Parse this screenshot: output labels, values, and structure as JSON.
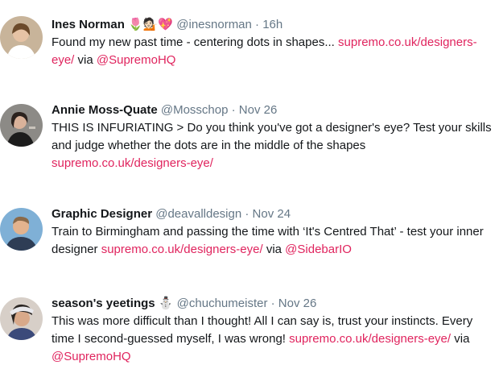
{
  "tweets": [
    {
      "name": "Ines Norman",
      "emojis": [
        "🌷",
        "💁🏻",
        "💖"
      ],
      "handle": "@inesnorman",
      "sep": "·",
      "time": "16h",
      "text1": "Found my new past time - centering dots in shapes... ",
      "link": "supremo.co.uk/designers-eye/",
      "text2": " via ",
      "mention": "@SupremoHQ",
      "avatar_colors": {
        "bg": "#c8b49a",
        "skin": "#e6c3a5",
        "hair": "#6b4a2b",
        "shirt": "#ffffff"
      }
    },
    {
      "name": "Annie Moss-Quate",
      "emojis": [],
      "handle": "@Mosschop",
      "sep": "·",
      "time": "Nov 26",
      "text1": "THIS IS INFURIATING > Do you think you've got a designer's eye? Test your skills and judge whether the dots are in the middle of the shapes",
      "link": "supremo.co.uk/designers-eye/",
      "text2": "",
      "mention": "",
      "avatar_colors": {
        "bg": "#8c8a86",
        "skin": "#d9b29a",
        "hair": "#2b221e",
        "shirt": "#1c1c1c"
      }
    },
    {
      "name": "Graphic Designer",
      "emojis": [],
      "handle": "@deavalldesign",
      "sep": "·",
      "time": "Nov 24",
      "text1": "Train to Birmingham and passing the time with ‘It's Centred That’ - test your inner designer ",
      "link": "supremo.co.uk/designers-eye/",
      "text2": " via ",
      "mention": "@SidebarIO",
      "avatar_colors": {
        "bg": "#7fb0d6",
        "skin": "#e3b38e",
        "hair": "#8a6a4a",
        "shirt": "#2e3d55"
      }
    },
    {
      "name": "season's yeetings",
      "emojis": [
        "⛄"
      ],
      "handle": "@chuchumeister",
      "sep": "·",
      "time": "Nov 26",
      "text1": "This was more difficult than I thought! All I can say is, trust your instincts. Every time I second-guessed myself, I was wrong! ",
      "link": "supremo.co.uk/designers-eye/",
      "text2": " via ",
      "mention": "@SupremoHQ",
      "avatar_colors": {
        "bg": "#d7cfc8",
        "skin": "#d8a98a",
        "hair": "#2a2522",
        "shirt": "#3b4a7a"
      }
    }
  ]
}
